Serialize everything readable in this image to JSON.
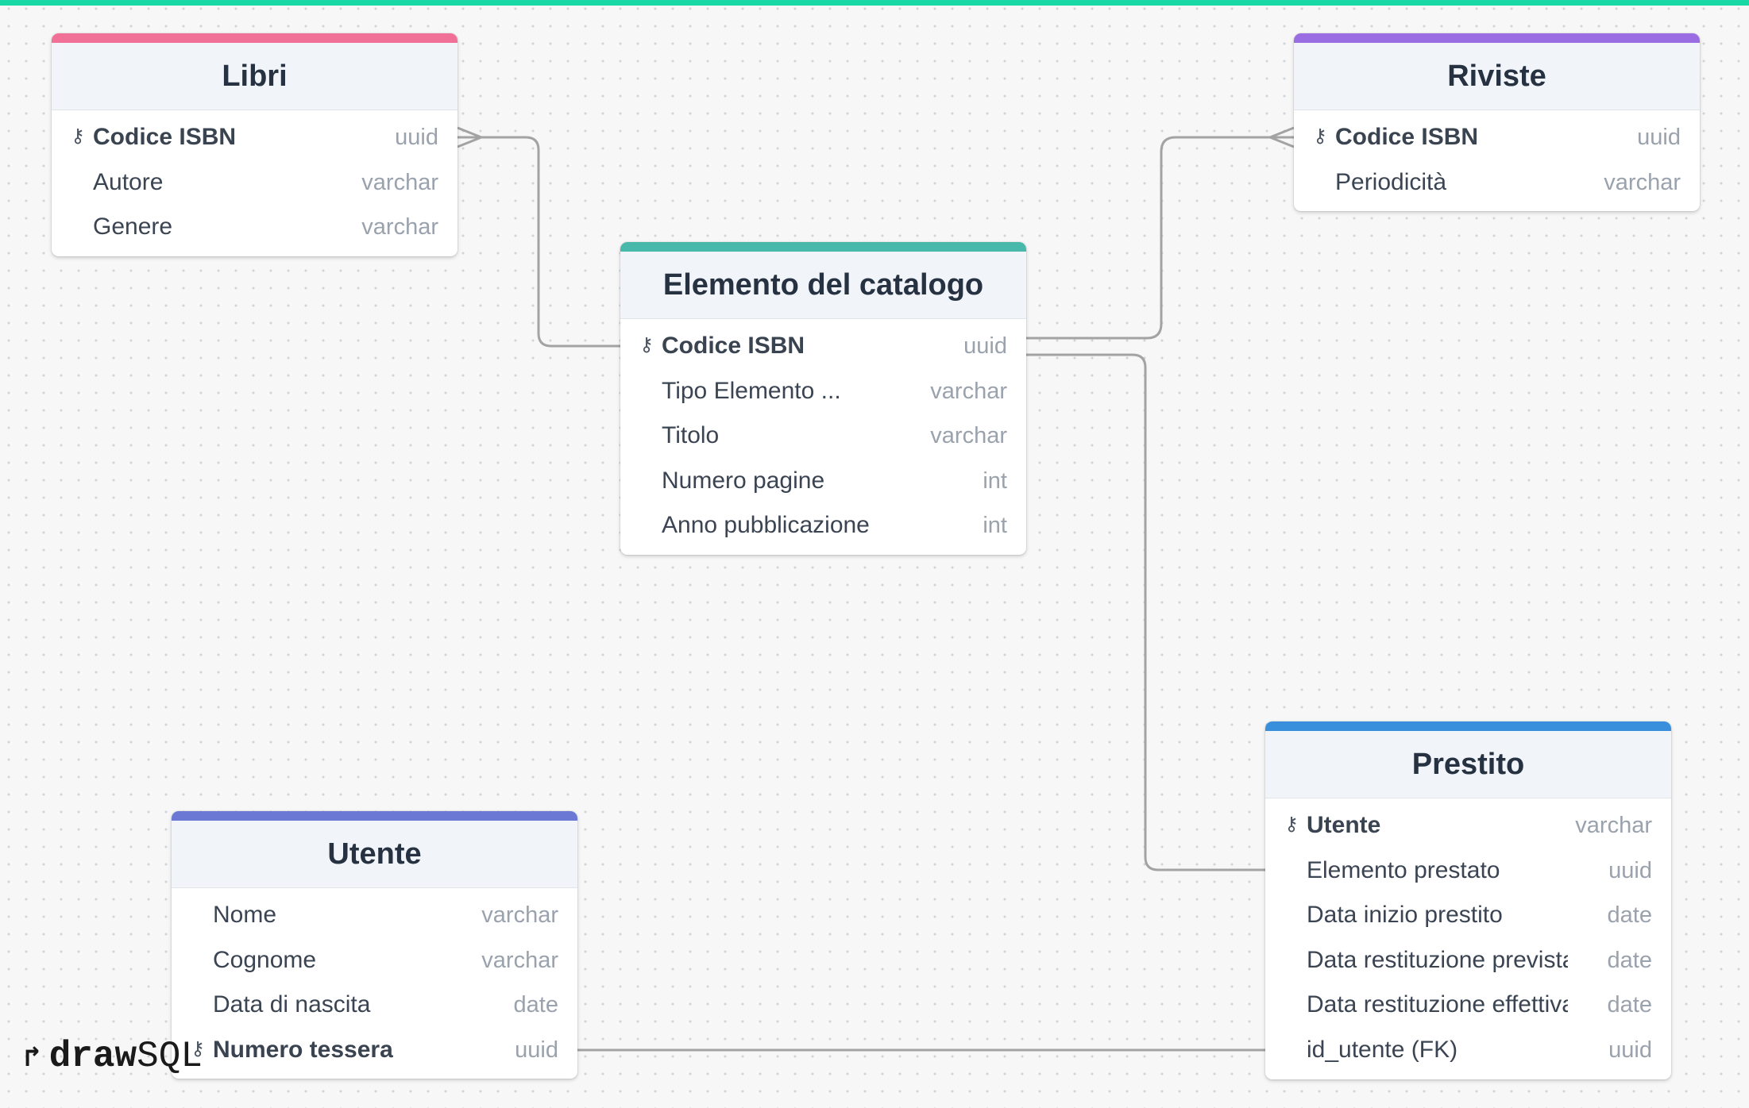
{
  "theme": {
    "top_bar_color": "#18d8a5",
    "connector_color": "#a3a3a3"
  },
  "tables": {
    "libri": {
      "title": "Libri",
      "accent": "#f17097",
      "columns": [
        {
          "name": "Codice ISBN",
          "type": "uuid",
          "pk": true
        },
        {
          "name": "Autore",
          "type": "varchar"
        },
        {
          "name": "Genere",
          "type": "varchar"
        }
      ]
    },
    "riviste": {
      "title": "Riviste",
      "accent": "#9b6de3",
      "columns": [
        {
          "name": "Codice ISBN",
          "type": "uuid",
          "pk": true
        },
        {
          "name": "Periodicità",
          "type": "varchar"
        }
      ]
    },
    "elemento": {
      "title": "Elemento del catalogo",
      "accent": "#47b8a9",
      "columns": [
        {
          "name": "Codice ISBN",
          "type": "uuid",
          "pk": true
        },
        {
          "name": "Tipo Elemento ...",
          "type": "varchar"
        },
        {
          "name": "Titolo",
          "type": "varchar"
        },
        {
          "name": "Numero pagine",
          "type": "int"
        },
        {
          "name": "Anno pubblicazione",
          "type": "int"
        }
      ]
    },
    "prestito": {
      "title": "Prestito",
      "accent": "#3a8fdd",
      "columns": [
        {
          "name": "Utente",
          "type": "varchar",
          "pk": true
        },
        {
          "name": "Elemento prestato",
          "type": "uuid"
        },
        {
          "name": "Data inizio prestito",
          "type": "date"
        },
        {
          "name": "Data restituzione prevista",
          "type": "date"
        },
        {
          "name": "Data restituzione effettiva",
          "type": "date"
        },
        {
          "name": "id_utente (FK)",
          "type": "uuid"
        }
      ]
    },
    "utente": {
      "title": "Utente",
      "accent": "#6b78d4",
      "columns": [
        {
          "name": "Nome",
          "type": "varchar"
        },
        {
          "name": "Cognome",
          "type": "varchar"
        },
        {
          "name": "Data di nascita",
          "type": "date"
        },
        {
          "name": "Numero tessera",
          "type": "uuid",
          "pk": true
        }
      ]
    }
  },
  "relationships": [
    {
      "from": "Elemento del catalogo.Codice ISBN",
      "to": "Libri.Codice ISBN",
      "cardinality": "many"
    },
    {
      "from": "Elemento del catalogo.Codice ISBN",
      "to": "Riviste.Codice ISBN",
      "cardinality": "many"
    },
    {
      "from": "Elemento del catalogo.Codice ISBN",
      "to": "Prestito.Elemento prestato",
      "cardinality": "one"
    },
    {
      "from": "Utente.Numero tessera",
      "to": "Prestito.id_utente (FK)",
      "cardinality": "one"
    }
  ],
  "logo": {
    "mark": "↱",
    "draw": "draw",
    "sql": "SQL"
  }
}
